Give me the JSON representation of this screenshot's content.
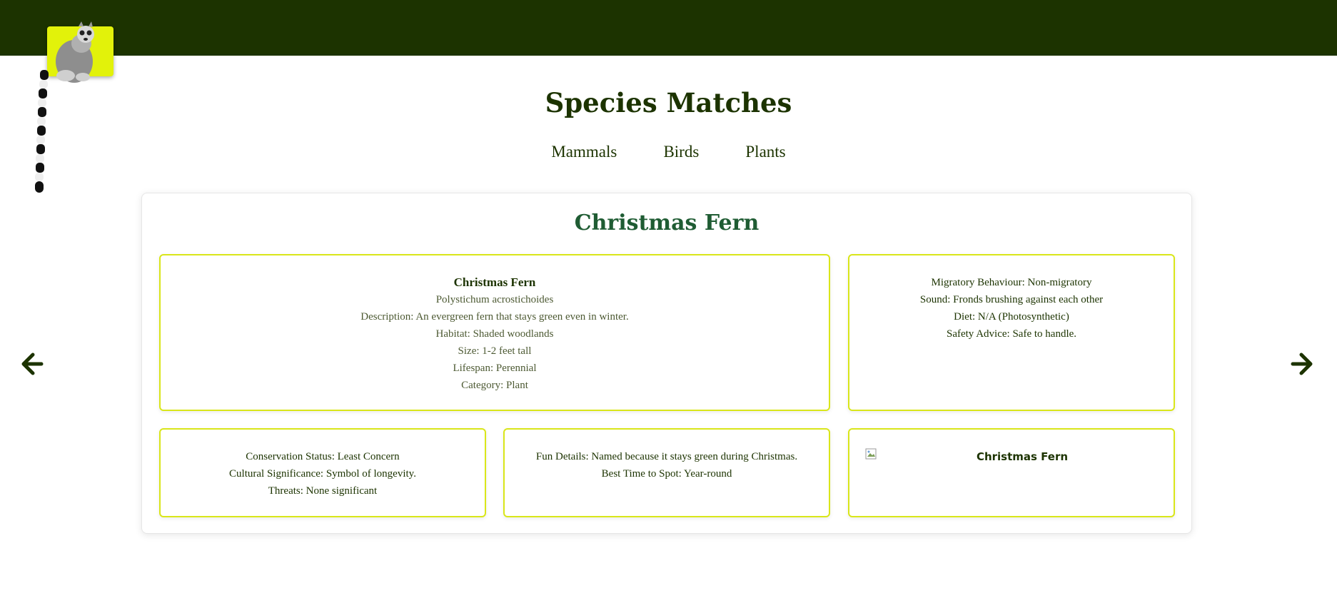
{
  "header": {
    "logo_icon": "lemur-logo-icon",
    "bar_color": "#1c3300",
    "logo_bg": "#e2f20a"
  },
  "page": {
    "title": "Species Matches"
  },
  "nav": {
    "items": [
      {
        "label": "Mammals"
      },
      {
        "label": "Birds"
      },
      {
        "label": "Plants"
      }
    ]
  },
  "controls": {
    "prev_icon": "arrow-left-icon",
    "next_icon": "arrow-right-icon"
  },
  "species": {
    "title": "Christmas Fern",
    "name": "Christmas Fern",
    "scientific": "Polystichum acrostichoides",
    "description": "Description: An evergreen fern that stays green even in winter.",
    "habitat": "Habitat: Shaded woodlands",
    "size": "Size: 1-2 feet tall",
    "lifespan": "Lifespan: Perennial",
    "category": "Category: Plant",
    "migratory": "Migratory Behaviour: Non-migratory",
    "sound": "Sound: Fronds brushing against each other",
    "diet": "Diet: N/A (Photosynthetic)",
    "safety": "Safety Advice: Safe to handle.",
    "conservation": "Conservation Status: Least Concern",
    "cultural": "Cultural Significance: Symbol of longevity.",
    "threats": "Threats: None significant",
    "fun": "Fun Details: Named because it stays green during Christmas.",
    "best_time": "Best Time to Spot: Year-round",
    "image_alt": "Christmas Fern"
  },
  "colors": {
    "accent_border": "#d9e61a",
    "title_green": "#1f5c33",
    "dark_green": "#1c3300"
  }
}
